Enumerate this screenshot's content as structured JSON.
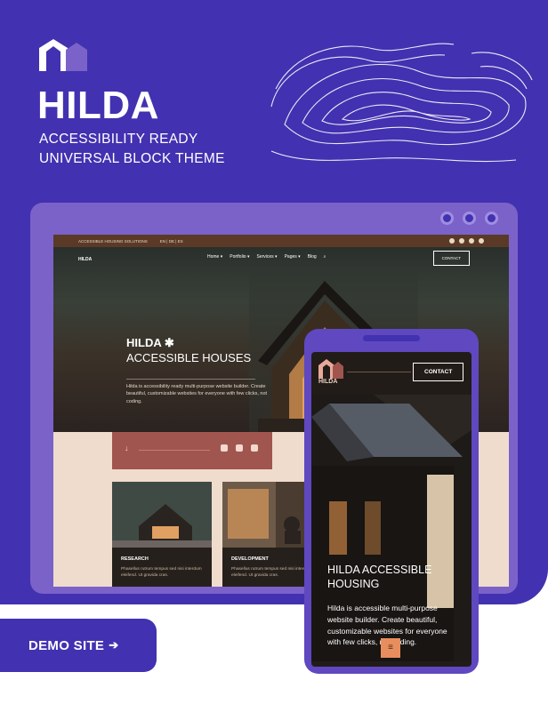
{
  "theme": {
    "name": "HILDA",
    "tagline_line1": "ACCESSIBILITY READY",
    "tagline_line2": "UNIVERSAL BLOCK THEME",
    "colors": {
      "primary": "#4231b0",
      "frame": "#7b62c9",
      "rose": "#a1554f",
      "cream": "#efdccd",
      "accent": "#e88e5e"
    }
  },
  "desktop_preview": {
    "utility_bar": {
      "left_text": "ACCESSIBLE HOUSING SOLUTIONS",
      "languages": "EN | DE | ES"
    },
    "logo_text": "HILDA",
    "menu": [
      "Home ▾",
      "Portfolio ▾",
      "Services ▾",
      "Pages ▾",
      "Blog",
      "⌕"
    ],
    "contact_button": "CONTACT",
    "hero_title": "HILDA ✱",
    "hero_subtitle": "ACCESSIBLE HOUSES",
    "hero_desc": "Hilda is accessibility ready multi-purpose website builder. Create beautiful, customizable websites for everyone with few clicks, not coding.",
    "cards": [
      {
        "title": "RESEARCH",
        "desc": "Phasellus rutrum tempus sed nisi interdum eleifend. Ut gravida cras."
      },
      {
        "title": "DEVELOPMENT",
        "desc": "Phasellus rutrum tempus sed nisi interdum eleifend. Ut gravida cras."
      }
    ]
  },
  "mobile_preview": {
    "logo_text": "HILDA",
    "contact_button": "CONTACT",
    "title": "HILDA ACCESSIBLE HOUSING",
    "desc": "Hilda is accessible multi-purpose website builder. Create beautiful, customizable websites for everyone with few clicks, not coding.",
    "menu_icon": "≡"
  },
  "cta": {
    "label": "DEMO SITE",
    "arrow": "➔"
  }
}
